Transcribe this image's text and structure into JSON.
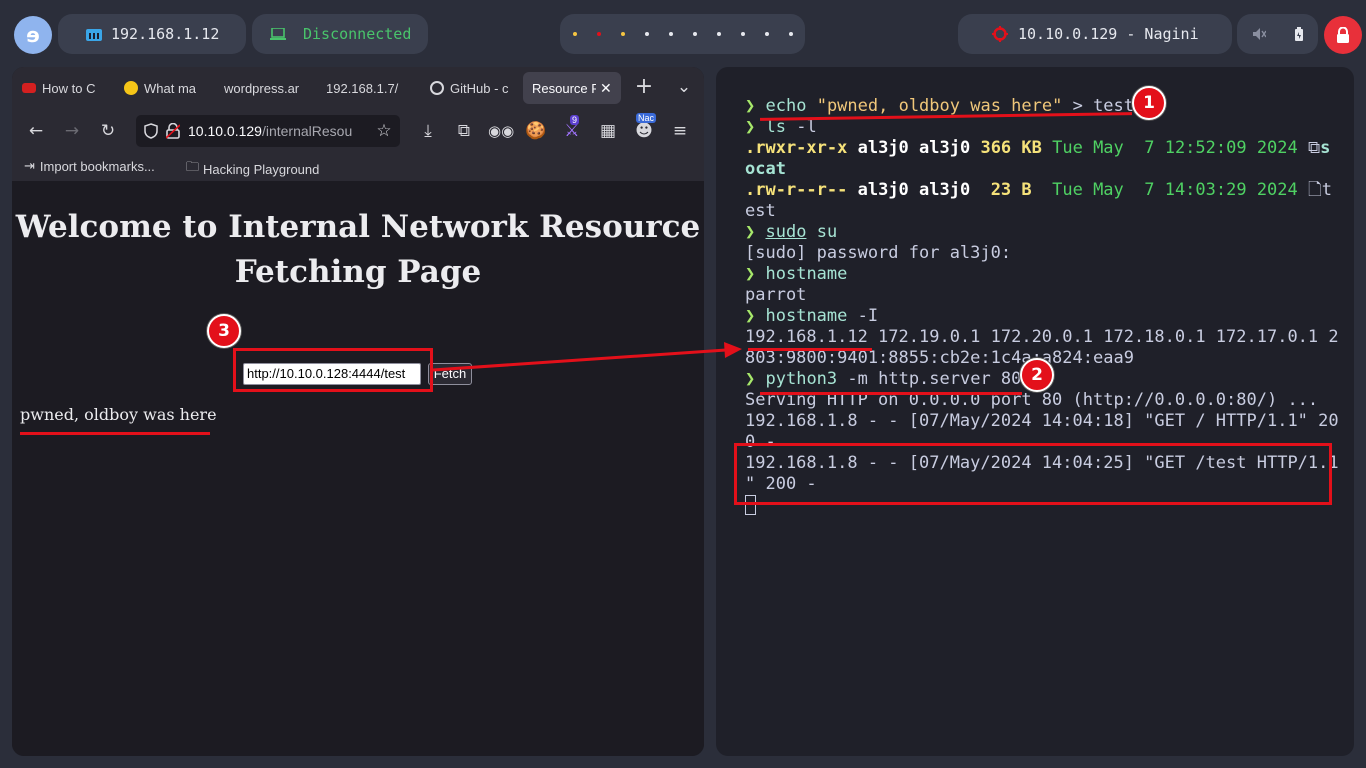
{
  "topbar": {
    "local_ip": "192.168.1.12",
    "vpn_status": "Disconnected",
    "target": "10.10.0.129 - Nagini",
    "debian_icon": "debian-swirl-icon",
    "workspace_dot_colors": [
      "#f5c542",
      "#e3101a",
      "#f5c542",
      "#e6e8ee",
      "#e6e8ee",
      "#e6e8ee",
      "#e6e8ee",
      "#e6e8ee",
      "#e6e8ee",
      "#e6e8ee"
    ]
  },
  "browser": {
    "tabs": [
      {
        "label": "How to C"
      },
      {
        "label": "What ma"
      },
      {
        "label": "wordpress.ar"
      },
      {
        "label": "192.168.1.7/"
      },
      {
        "label": "GitHub - c"
      },
      {
        "label": "Resource F",
        "active": true
      }
    ],
    "url_host": "10.10.0.129",
    "url_path": "/internalResou",
    "bookmarks": [
      "Import bookmarks...",
      "Hacking Playground"
    ],
    "extension_badges": {
      "nine": "9",
      "nac": "Nac"
    },
    "page": {
      "title_line1": "Welcome to Internal Network Resource",
      "title_line2": "Fetching Page",
      "input_value": "http://10.10.0.128:4444/test",
      "fetch_label": "Fetch",
      "result_text": "pwned, oldboy was here"
    }
  },
  "terminal": {
    "lines": {
      "l1_cmd": "echo",
      "l1_str": "\"pwned, oldboy was here\"",
      "l1_rest": "> test",
      "l2_cmd": "ls",
      "l2_flag": "-l",
      "l3_perm": ".rwxr-xr-x",
      "l3_user": "al3j0 al3j0",
      "l3_size": "366 KB",
      "l3_date": "Tue May  7 12:52:09 2024",
      "l3_file": "s",
      "l4": "ocat",
      "l5_perm": ".rw-r--r--",
      "l5_user": "al3j0 al3j0",
      "l5_size": " 23 B ",
      "l5_date": "Tue May  7 14:03:29 2024",
      "l5_file": "t",
      "l6": "est",
      "l7_cmd": "sudo",
      "l7_rest": "su",
      "l8": "[sudo] password for al3j0:",
      "l9_cmd": "hostname",
      "l10": "parrot",
      "l11_cmd": "hostname",
      "l11_flag": "-I",
      "l12": "192.168.1.12 172.19.0.1 172.20.0.1 172.18.0.1 172.17.0.1 2",
      "l13": "803:9800:9401:8855:cb2e:1c4a:a824:eaa9",
      "l14_cmd": "python3",
      "l14_rest": "-m http.server 80",
      "l15": "Serving HTTP on 0.0.0.0 port 80 (http://0.0.0.0:80/) ...",
      "l16": "192.168.1.8 - - [07/May/2024 14:04:18] \"GET / HTTP/1.1\" 20",
      "l17": "0 -",
      "l18": "192.168.1.8 - - [07/May/2024 14:04:25] \"GET /test HTTP/1.1",
      "l19": "\" 200 -"
    },
    "prompt": "❯"
  },
  "annotations": {
    "badge1": "1",
    "badge2": "2",
    "badge3": "3"
  }
}
